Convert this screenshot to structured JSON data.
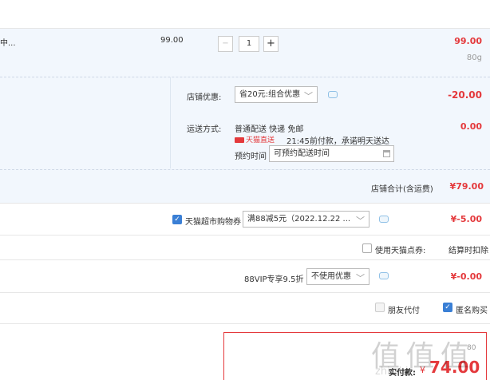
{
  "item": {
    "name": "中...",
    "unit_price": "99.00",
    "qty_minus": "−",
    "qty_value": "1",
    "qty_plus": "+",
    "subtotal": "99.00",
    "weight": "80g"
  },
  "shop": {
    "coupon_label": "店铺优惠:",
    "coupon_value": "省20元:组合优惠",
    "coupon_amount": "-20.00",
    "shipping_label": "运送方式:",
    "shipping_method": "普通配送 快递 免邮",
    "shipping_badge": "天猫直送",
    "shipping_note": "21:45前付款，承诺明天送达",
    "shipping_amount": "0.00",
    "appoint_label": "预约时间",
    "appoint_value": "可预约配送时间",
    "total_label": "店铺合计(含运费)",
    "total_value": "¥79.00"
  },
  "voucher": {
    "label": "天猫超市购物券",
    "value": "满88减5元（2022.12.22 ...",
    "amount": "¥-5.00",
    "checked": true
  },
  "points": {
    "label": "使用天猫点券:",
    "note": "结算时扣除",
    "checked": false
  },
  "vip": {
    "label": "88VIP专享9.5折",
    "value": "不使用优惠",
    "amount": "¥-0.00"
  },
  "options": {
    "friend_pay": "朋友代付",
    "friend_checked": false,
    "anon_buy": "匿名购买",
    "anon_checked": true
  },
  "payment": {
    "label": "实付款:",
    "currency": "¥",
    "value": "74.00",
    "weight_hint": "80"
  },
  "watermark": {
    "logo": "值 值 值",
    "site": "zhi.zhi"
  },
  "colors": {
    "accent_red": "#e4393c",
    "panel_blue": "#f2f7fd",
    "link_blue": "#3a7fd5"
  }
}
